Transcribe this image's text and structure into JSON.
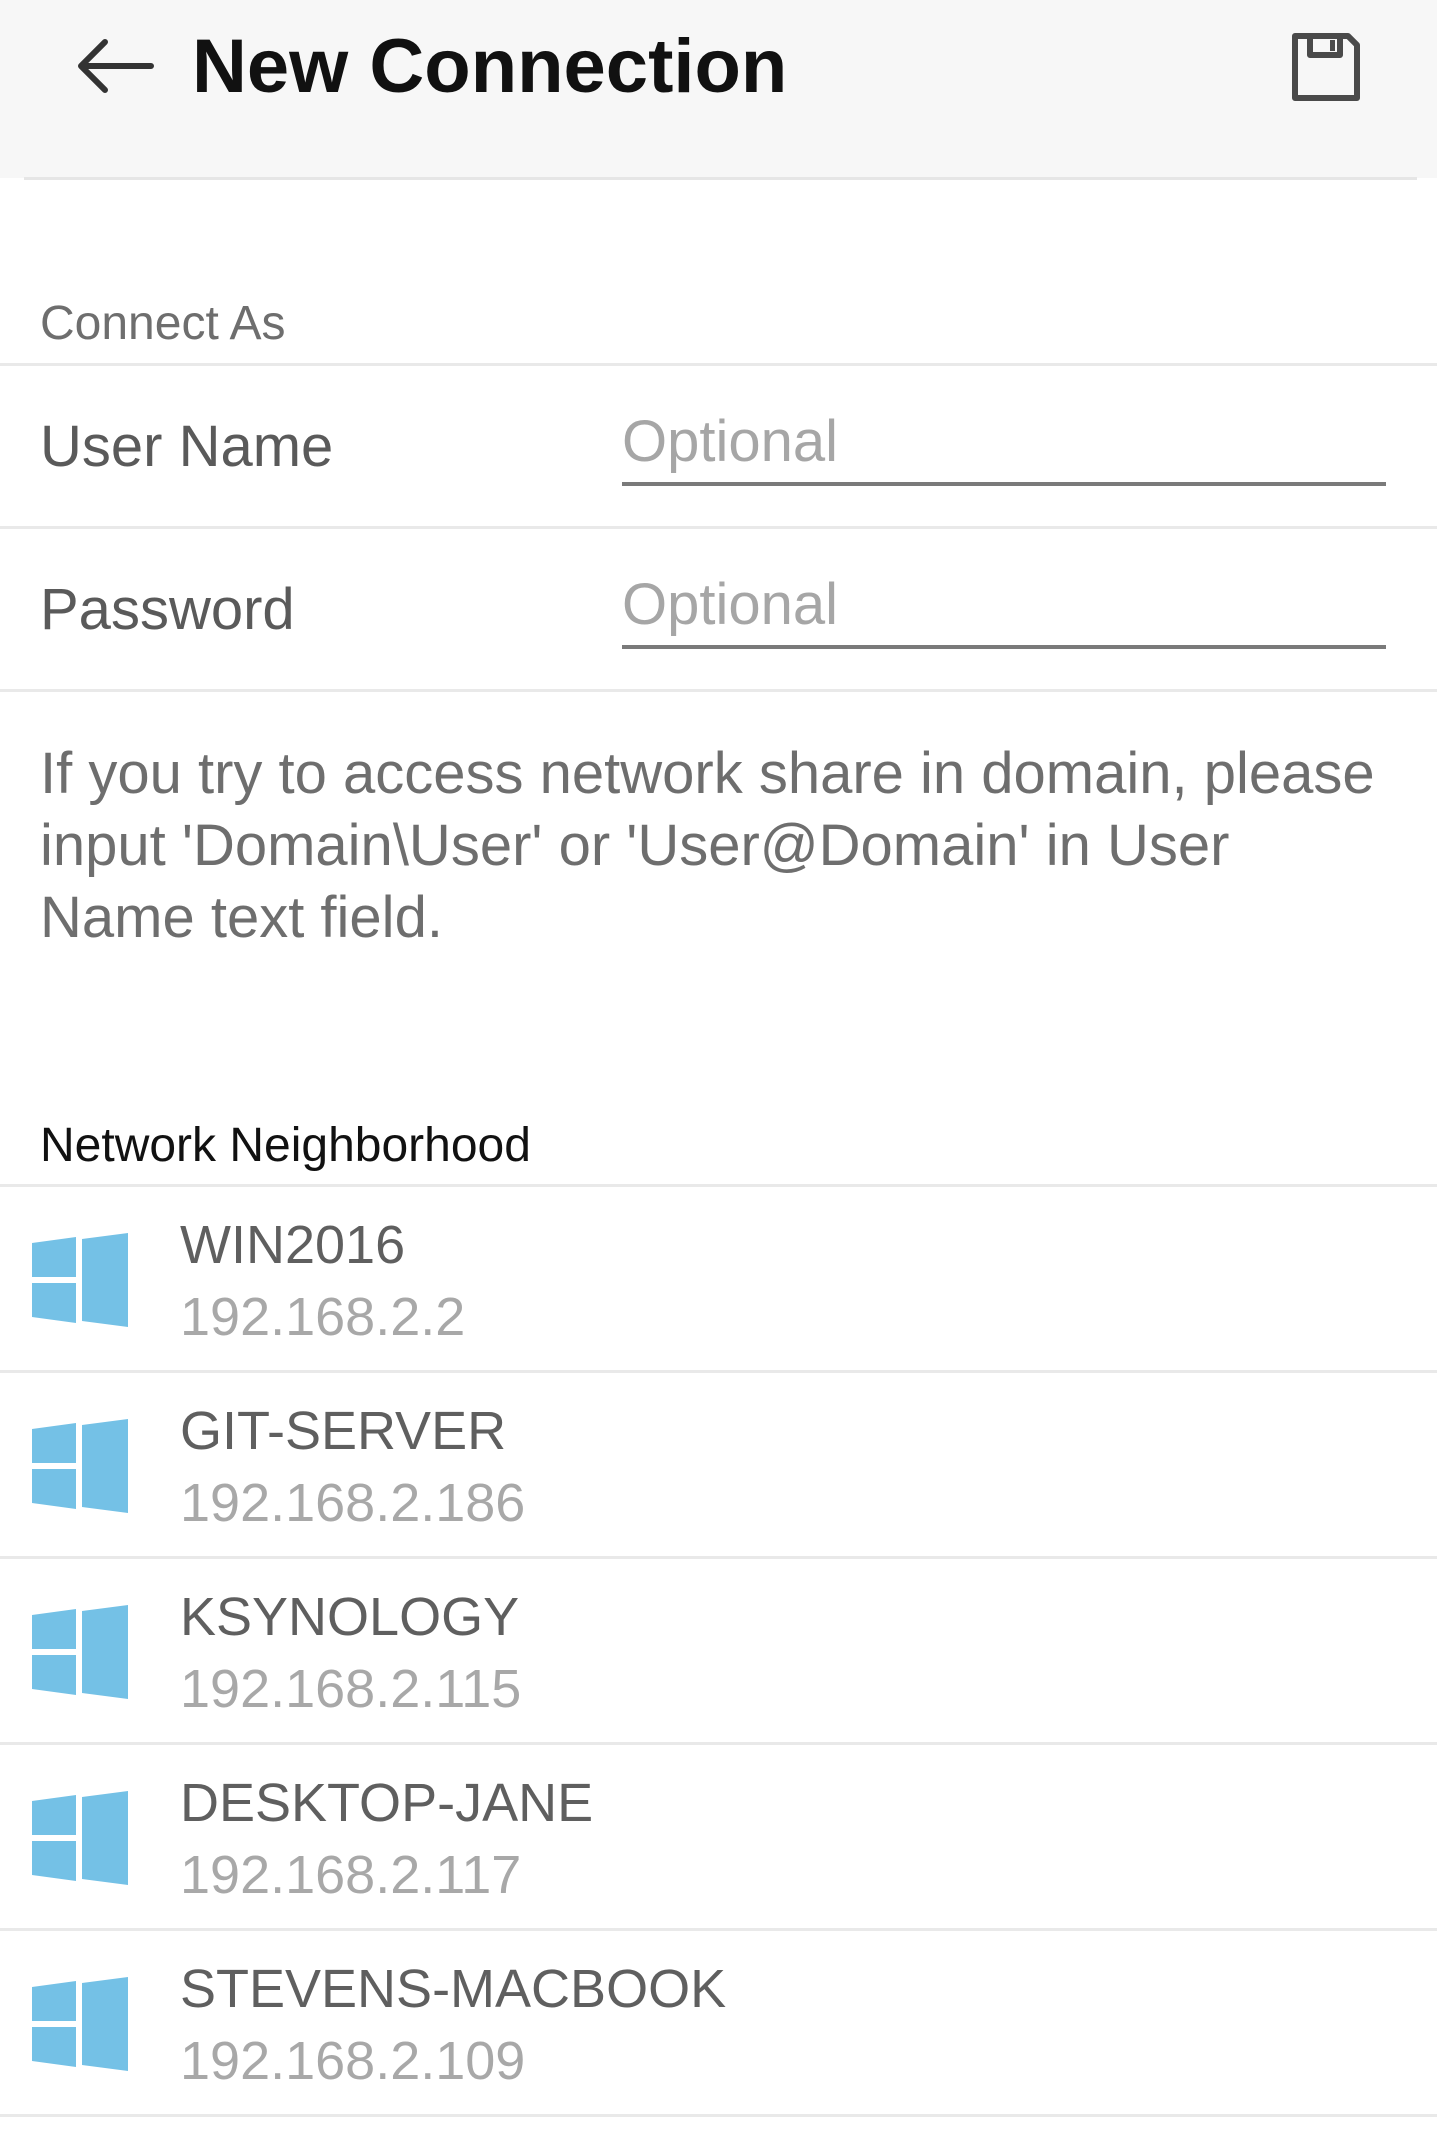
{
  "header": {
    "title": "New Connection",
    "back_icon": "arrow-left-icon",
    "save_icon": "floppy-disk-icon"
  },
  "connect_as": {
    "section_title": "Connect As",
    "username": {
      "label": "User Name",
      "placeholder": "Optional",
      "value": ""
    },
    "password": {
      "label": "Password",
      "placeholder": "Optional",
      "value": ""
    },
    "hint": "If you try to access network share in domain, please input 'Domain\\User' or 'User@Domain' in User Name text field."
  },
  "network": {
    "section_title": "Network Neighborhood",
    "icon": "windows-logo-icon",
    "icon_color": "#74c1e6",
    "items": [
      {
        "name": "WIN2016",
        "ip": "192.168.2.2"
      },
      {
        "name": "GIT-SERVER",
        "ip": "192.168.2.186"
      },
      {
        "name": "KSYNOLOGY",
        "ip": "192.168.2.115"
      },
      {
        "name": "DESKTOP-JANE",
        "ip": "192.168.2.117"
      },
      {
        "name": "STEVENS-MACBOOK",
        "ip": "192.168.2.109"
      }
    ]
  }
}
